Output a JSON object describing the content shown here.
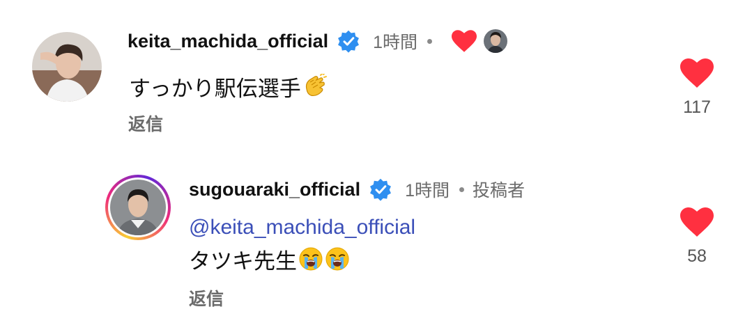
{
  "comments": [
    {
      "username": "keita_machida_official",
      "time": "1時間",
      "text": "すっかり駅伝選手",
      "emoji": "clapping-hands",
      "reply_label": "返信",
      "like_count": "117",
      "liked_by_author": true
    }
  ],
  "replies": [
    {
      "username": "sugouaraki_official",
      "time": "1時間",
      "author_label": "投稿者",
      "mention": "@keita_machida_official",
      "text": "タツキ先生",
      "emoji": "loudly-crying-face",
      "emoji_count": 2,
      "reply_label": "返信",
      "like_count": "58"
    }
  ],
  "colors": {
    "heart": "#ff3040",
    "verified": "#2f8ff0",
    "mention": "#3b4fb8",
    "muted": "#6b6b6b"
  }
}
